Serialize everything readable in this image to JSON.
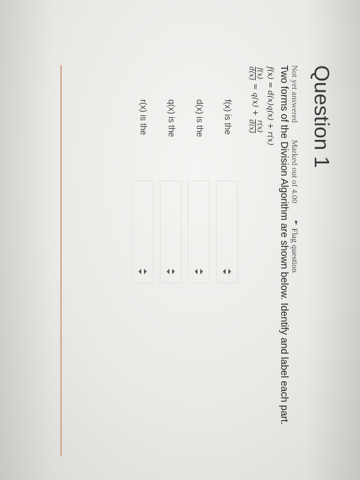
{
  "question": {
    "title": "Question 1",
    "status": "Not yet answered",
    "marks": "Marked out of 4.00",
    "flag_label": "Flag question",
    "text": "Two forms of the Division Algorithm are shown below. Identify and label each part.",
    "equation1": "f(x) = d(x)q(x) + r(x)",
    "equation2": {
      "lhs_num": "f(x)",
      "lhs_den": "d(x)",
      "middle": "= q(x) +",
      "rhs_num": "r(x)",
      "rhs_den": "d(x)"
    }
  },
  "answers": [
    {
      "label": "f(x) is the",
      "selected": ""
    },
    {
      "label": "d(x) is the",
      "selected": ""
    },
    {
      "label": "q(x) is the",
      "selected": ""
    },
    {
      "label": "r(x) is the",
      "selected": ""
    }
  ],
  "colors": {
    "divider": "#d4a38f",
    "background": "#f4f4f2"
  }
}
